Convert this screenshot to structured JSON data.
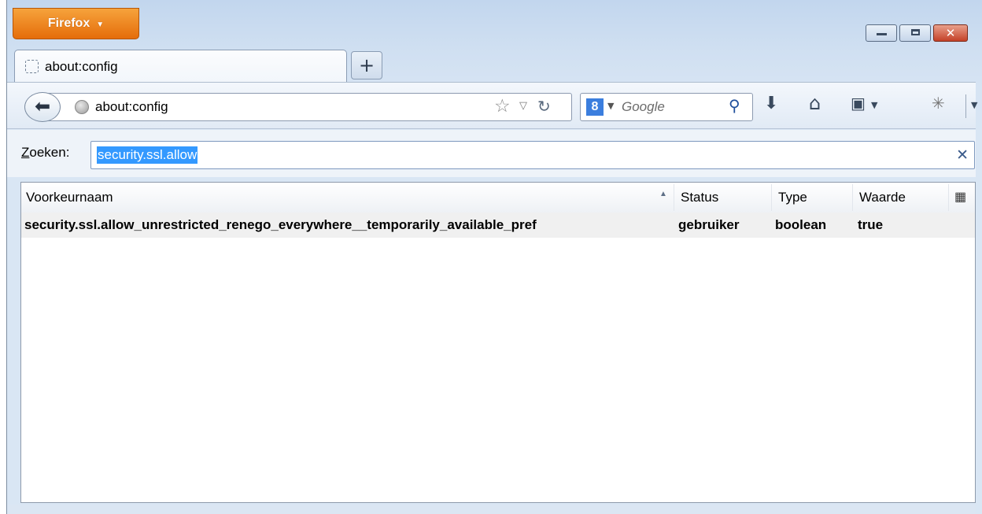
{
  "browser": {
    "menu_button_label": "Firefox",
    "menu_button_caret": "▼",
    "window_controls": {
      "minimize": "minimize",
      "maximize": "maximize",
      "close": "✕"
    }
  },
  "tabs": [
    {
      "label": "about:config"
    }
  ],
  "new_tab_label": "+",
  "toolbar": {
    "url": "about:config",
    "search_placeholder": "Google",
    "search_engine_letter": "8",
    "icons": [
      "back-icon",
      "site-identity-icon",
      "star-icon",
      "dropdown-icon",
      "reload-icon",
      "search-icon",
      "downloads-icon",
      "home-icon",
      "bookmarks-icon",
      "addon-icon",
      "menu-dropdown-icon"
    ]
  },
  "find": {
    "label_prefix": "Z",
    "label_rest": "oeken:",
    "value": "security.ssl.allow",
    "clear": "✕"
  },
  "table": {
    "columns": [
      "Voorkeurnaam",
      "Status",
      "Type",
      "Waarde"
    ],
    "sort_indicator": "▲",
    "rows": [
      {
        "name": "security.ssl.allow_unrestricted_renego_everywhere__temporarily_available_pref",
        "status": "gebruiker",
        "type": "boolean",
        "value": "true"
      }
    ]
  },
  "colors": {
    "firefox_orange": "#e56d0a",
    "selection_blue": "#3399ff",
    "chrome_blue": "#d5e3f3"
  }
}
